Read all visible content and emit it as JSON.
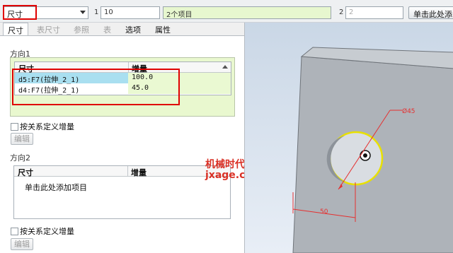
{
  "topbar": {
    "type_value": "尺寸",
    "idx1": "1",
    "field1": "10",
    "items_label": "2个项目",
    "idx2": "2",
    "field2": "2",
    "add_button": "单击此处添"
  },
  "tabs": [
    {
      "label": "尺寸",
      "active": true
    },
    {
      "label": "表尺寸",
      "enabled": false
    },
    {
      "label": "参照",
      "enabled": false
    },
    {
      "label": "表",
      "enabled": false
    },
    {
      "label": "选项",
      "enabled": true
    },
    {
      "label": "属性",
      "enabled": true
    }
  ],
  "direction1": {
    "title": "方向1",
    "col_dim": "尺寸",
    "col_inc": "增量",
    "rows": [
      {
        "dim": "d5:F7(拉伸_2_1)",
        "inc": "100.0"
      },
      {
        "dim": "d4:F7(拉伸_2_1)",
        "inc": "45.0"
      }
    ],
    "checkbox": "按关系定义增量",
    "edit_button": "编辑"
  },
  "direction2": {
    "title": "方向2",
    "col_dim": "尺寸",
    "col_inc": "增量",
    "add_text": "单击此处添加项目",
    "checkbox": "按关系定义增量",
    "edit_button": "编辑"
  },
  "watermark": {
    "line1": "机械时代网",
    "line2": "jxage.com"
  },
  "model": {
    "diameter_label": "Ø45",
    "dist_label": "50"
  },
  "colors": {
    "highlight_red": "#e00000",
    "selection_blue": "#a9dff0",
    "group_green": "#e9f8cf",
    "hole_yellow": "#e8e000"
  }
}
